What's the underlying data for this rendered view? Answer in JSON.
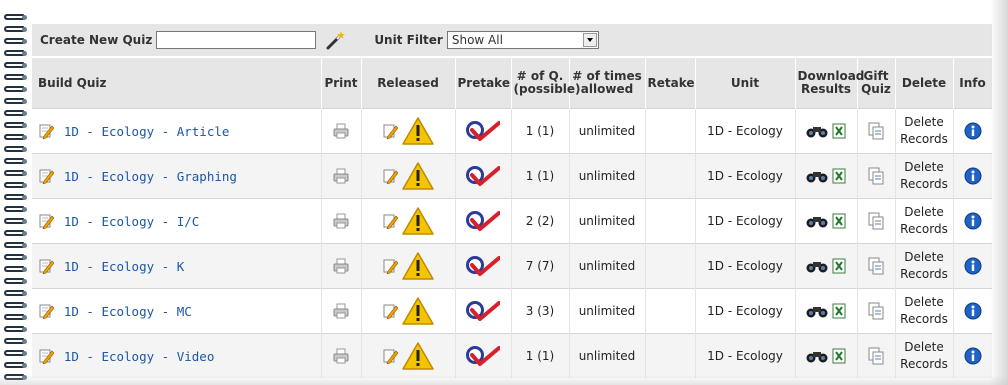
{
  "toolbar": {
    "create_label": "Create New Quiz",
    "create_input_value": "",
    "unit_filter_label": "Unit Filter",
    "unit_filter_selected": "Show All"
  },
  "columns": {
    "build_quiz": "Build Quiz",
    "print": "Print",
    "released": "Released",
    "pretake": "Pretake",
    "num_q": "# of Q. (possible)",
    "times_allowed": "# of times allowed",
    "retake": "Retake",
    "unit": "Unit",
    "download_results": "Download Results",
    "gift_quiz": "Gift Quiz",
    "delete": "Delete",
    "info": "Info"
  },
  "rows": [
    {
      "name": "1D - Ecology - Article",
      "num_q": "1 (1)",
      "times_allowed": "unlimited",
      "retake": "",
      "unit": "1D - Ecology",
      "delete": "Delete Records"
    },
    {
      "name": "1D - Ecology - Graphing",
      "num_q": "1 (1)",
      "times_allowed": "unlimited",
      "retake": "",
      "unit": "1D - Ecology",
      "delete": "Delete Records"
    },
    {
      "name": "1D - Ecology - I/C",
      "num_q": "2 (2)",
      "times_allowed": "unlimited",
      "retake": "",
      "unit": "1D - Ecology",
      "delete": "Delete Records"
    },
    {
      "name": "1D - Ecology - K",
      "num_q": "7 (7)",
      "times_allowed": "unlimited",
      "retake": "",
      "unit": "1D - Ecology",
      "delete": "Delete Records"
    },
    {
      "name": "1D - Ecology - MC",
      "num_q": "3 (3)",
      "times_allowed": "unlimited",
      "retake": "",
      "unit": "1D - Ecology",
      "delete": "Delete Records"
    },
    {
      "name": "1D - Ecology - Video",
      "num_q": "1 (1)",
      "times_allowed": "unlimited",
      "retake": "",
      "unit": "1D - Ecology",
      "delete": "Delete Records"
    }
  ],
  "icons": {
    "edit": "pencil-note-icon",
    "print": "printer-icon",
    "warning": "warning-triangle-icon",
    "pretake": "check-mark-icon",
    "download": "binoculars-icon",
    "excel": "excel-icon",
    "gift": "copy-pages-icon",
    "info": "info-icon",
    "wand": "magic-wand-icon"
  },
  "colors": {
    "link": "#1a57a8",
    "header_bg": "#e6e6e6",
    "warning": "#f5c400",
    "check": "#d8202a",
    "info": "#1f63c6"
  }
}
